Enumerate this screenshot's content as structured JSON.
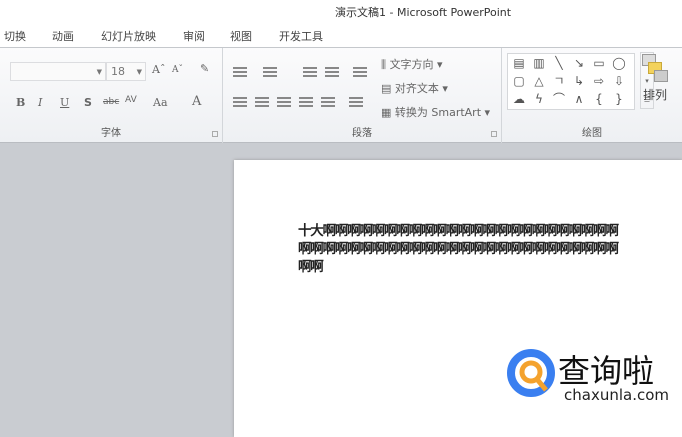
{
  "window": {
    "title": "演示文稿1 - Microsoft PowerPoint"
  },
  "tabs": [
    "切换",
    "动画",
    "幻灯片放映",
    "审阅",
    "视图",
    "开发工具"
  ],
  "font_group": {
    "label": "字体",
    "font_name": "",
    "font_size": "18",
    "bold": "B",
    "italic": "I",
    "underline": "U",
    "shadow": "S",
    "strike": "abc",
    "spacing": "AV",
    "case": "Aa",
    "color": "A"
  },
  "paragraph_group": {
    "label": "段落",
    "text_direction": "文字方向",
    "align_text": "对齐文本",
    "convert_smartart": "转换为 SmartArt"
  },
  "drawing_group": {
    "label": "绘图",
    "arrange": "排列",
    "shapes": [
      "▤",
      "▥",
      "╲",
      "↘",
      "▭",
      "◯",
      "▢",
      "△",
      "ㄱ",
      "↳",
      "⇨",
      "⇩",
      "☁",
      "ϟ",
      "⌒",
      "∧",
      "{",
      "}"
    ]
  },
  "slide": {
    "text": "十大啊啊啊啊啊啊啊啊啊啊啊啊啊啊啊啊啊啊啊啊啊啊啊啊啊啊啊啊啊啊啊啊啊啊啊啊啊啊啊啊啊啊啊啊啊啊啊啊啊啊啊啊"
  },
  "watermark": {
    "name": "查询啦",
    "domain": "chaxunla.com"
  }
}
